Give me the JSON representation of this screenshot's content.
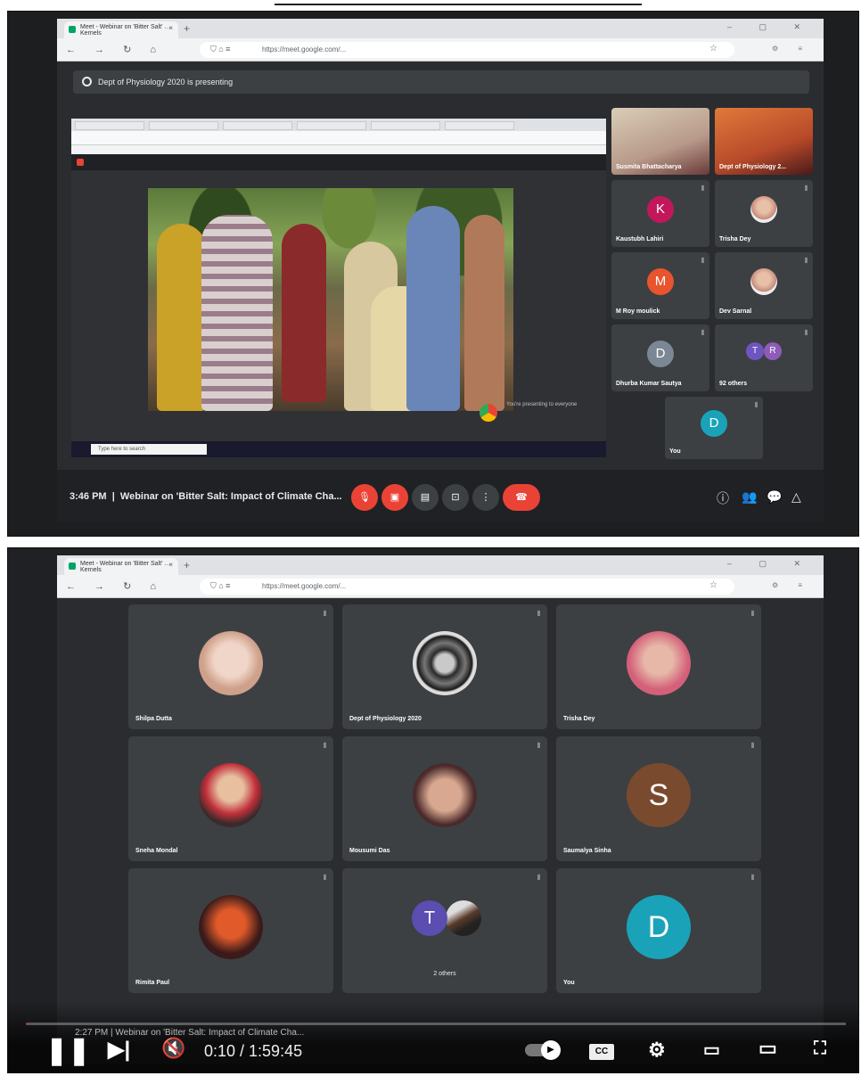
{
  "browser": {
    "tab_title": "Meet - Webinar on 'Bitter Salt' …",
    "tab_subtitle": "Kernels",
    "url": "https://meet.google.com/...",
    "new_tab": "+",
    "window_controls": "– ▢ ✕"
  },
  "screen1": {
    "banner": "Dept of Physiology 2020 is presenting",
    "shared_notice": "You're presenting to everyone",
    "taskbar_search": "Type here to search",
    "participants": [
      {
        "name": "Susmita Bhattacharya",
        "type": "video"
      },
      {
        "name": "Dept of Physiology 2...",
        "type": "video"
      },
      {
        "name": "Kaustubh Lahiri",
        "initial": "K",
        "color": "#c2185b"
      },
      {
        "name": "Trisha Dey",
        "type": "photo"
      },
      {
        "name": "M Roy moulick",
        "initial": "M",
        "color": "#e8542e"
      },
      {
        "name": "Dev Sarnal",
        "type": "photo"
      },
      {
        "name": "Dhurba Kumar Sautya",
        "initial": "D",
        "color": "#7b8794"
      },
      {
        "name": "92 others",
        "initials": [
          "T",
          "R"
        ]
      },
      {
        "name": "You",
        "initial": "D",
        "color": "#1aa3b8"
      }
    ],
    "time": "3:46 PM",
    "meeting_title": "Webinar on 'Bitter Salt: Impact of Climate Cha..."
  },
  "screen2": {
    "participants": [
      {
        "name": "Shilpa Dutta",
        "type": "photo"
      },
      {
        "name": "Dept of Physiology 2020",
        "type": "emblem"
      },
      {
        "name": "Trisha Dey",
        "type": "photo"
      },
      {
        "name": "Sneha Mondal",
        "type": "photo"
      },
      {
        "name": "Mousumi Das",
        "type": "photo"
      },
      {
        "name": "Saumalya Sinha",
        "initial": "S",
        "color": "#7a4a2e"
      },
      {
        "name": "Rimita Paul",
        "type": "photo"
      },
      {
        "name": "",
        "initial": "T",
        "color": "#5c4db1",
        "sub": "2 others"
      },
      {
        "name": "You",
        "initial": "D",
        "color": "#1aa3b8"
      }
    ],
    "time": "2:27 PM",
    "meeting_title": "Webinar on 'Bitter Salt: Impact of Climate Cha..."
  },
  "player": {
    "time_display": "0:10 / 1:59:45",
    "progress": 0.0014,
    "cc_label": "CC",
    "progress_color": "#ff0000"
  }
}
